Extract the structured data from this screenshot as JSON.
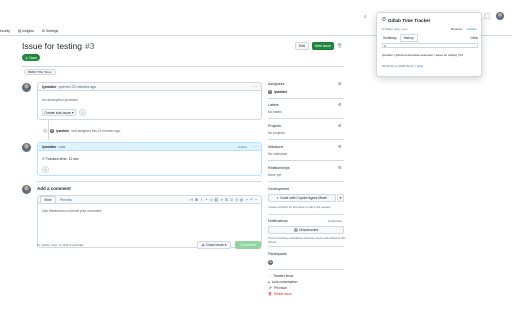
{
  "nav": {
    "tabs": [
      {
        "label": "ecurity",
        "icon": "shield-icon"
      },
      {
        "label": "Insights",
        "icon": "graph-icon"
      },
      {
        "label": "Settings",
        "icon": "gear-icon"
      }
    ]
  },
  "issue": {
    "title": "Issue for testing",
    "number": "#3",
    "status": "Open",
    "edit_label": "Edit",
    "new_issue_label": "New issue",
    "label_chip": "BDBUT Bot Timer"
  },
  "timeline": {
    "comment1": {
      "author": "lywolder",
      "meta": "opened 22 minutes ago",
      "body": "No description provided.",
      "create_sub_issue": "Create sub-issue"
    },
    "event": {
      "author": "lywolder",
      "meta": "self-assigned this 22 minutes ago"
    },
    "comment2": {
      "author": "lywolder",
      "meta": "now",
      "role": "Author",
      "body": "Tracked time: 12 sec"
    }
  },
  "composer": {
    "heading": "Add a comment",
    "tab_write": "Write",
    "tab_preview": "Preview",
    "placeholder": "Use Markdown to format your comment",
    "footer_hint": "Paste, drop, or click to add files",
    "close_issue": "Close issue",
    "comment_btn": "Comment"
  },
  "sidebar": {
    "assignees": {
      "title": "Assignees",
      "value": "lywolder"
    },
    "labels": {
      "title": "Labels",
      "value": "No labels"
    },
    "projects": {
      "title": "Projects",
      "value": "No projects"
    },
    "milestone": {
      "title": "Milestone",
      "value": "No milestone"
    },
    "relationships": {
      "title": "Relationships",
      "value": "None yet"
    },
    "development": {
      "title": "Development",
      "copilot_btn": "Code with Copilot Agent Mode",
      "hint": "Create a branch for this issue or link a pull request."
    },
    "notifications": {
      "title": "Notifications",
      "customize": "Customize",
      "unsubscribe": "Unsubscribe",
      "note": "You're receiving notifications because you're subscribed to this thread."
    },
    "participants": {
      "title": "Participants"
    },
    "actions": [
      {
        "label": "Transfer issue",
        "icon": "arrow-right-icon",
        "danger": false
      },
      {
        "label": "Lock conversation",
        "icon": "lock-icon",
        "danger": false
      },
      {
        "label": "Pin issue",
        "icon": "pin-icon",
        "danger": false
      },
      {
        "label": "Delete issue",
        "icon": "trash-icon",
        "danger": true
      }
    ]
  },
  "popup": {
    "title": "Gitlab Time Tracker",
    "user": "Token: ghp_••••••",
    "remove": "Remove",
    "cancel": "Cancel",
    "tab_summary": "Summary",
    "tab_history": "History",
    "clear": "Clear",
    "entry_value": "0",
    "entry_line": "lywolder / github-timetracker-extension | Issue for testing | #3",
    "entry_time": "00:00:12 on 2025-03-11",
    "view": "View"
  },
  "colors": {
    "green": "#1f883d",
    "blue": "#0969da",
    "danger": "#d1242f"
  }
}
